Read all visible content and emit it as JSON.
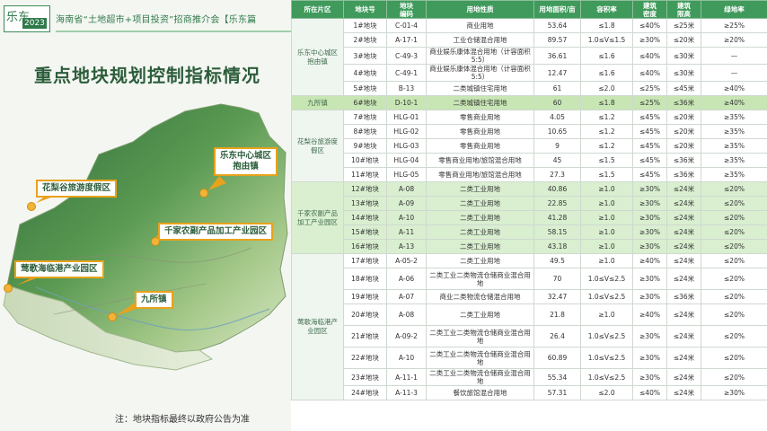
{
  "header": {
    "logo_mark": "乐东",
    "logo_year": "2023",
    "title": "海南省“土地超市+项目投资”招商推介会【乐东篇"
  },
  "main_title": "重点地块规划控制指标情况",
  "map_labels": {
    "center": "乐东中心城区\n抱由镇",
    "huali": "花梨谷旅游度假区",
    "qianjia": "千家农副产品加工产业园区",
    "yingge": "莺歌海临港产业园区",
    "jiusuo": "九所镇"
  },
  "note": "注：地块指标最终以政府公告为准",
  "table": {
    "headers": [
      "所在片区",
      "地块号",
      "地块\n编码",
      "用地性质",
      "用地面积/亩",
      "容积率",
      "建筑\n密度",
      "建筑\n限高",
      "绿地率"
    ],
    "groups": [
      {
        "area": "乐东中心城区\n抱由镇",
        "rows": [
          [
            "1#地块",
            "C-01-4",
            "商业用地",
            "53.64",
            "≤1.8",
            "≤40%",
            "≤25米",
            "≥25%"
          ],
          [
            "2#地块",
            "A-17-1",
            "工业仓储混合用地",
            "89.57",
            "1.0≤V≤1.5",
            "≥30%",
            "≤20米",
            "≥20%"
          ],
          [
            "3#地块",
            "C-49-3",
            "商业娱乐康体混合用地（计容面积5:5）",
            "36.61",
            "≤1.6",
            "≤40%",
            "≤30米",
            "—"
          ],
          [
            "4#地块",
            "C-49-1",
            "商业娱乐康体混合用地（计容面积5:5）",
            "12.47",
            "≤1.6",
            "≤40%",
            "≤30米",
            "—"
          ],
          [
            "5#地块",
            "B-13",
            "二类城镇住宅用地",
            "61",
            "≤2.0",
            "≤25%",
            "≤45米",
            "≥40%"
          ]
        ]
      },
      {
        "area": "九所镇",
        "highlight": true,
        "rows": [
          [
            "6#地块",
            "D-10-1",
            "二类城镇住宅用地",
            "60",
            "≤1.8",
            "≤25%",
            "≤36米",
            "≥40%"
          ]
        ]
      },
      {
        "area": "花梨谷旅游度\n假区",
        "rows": [
          [
            "7#地块",
            "HLG-01",
            "零售商业用地",
            "4.05",
            "≤1.2",
            "≤45%",
            "≤20米",
            "≥35%"
          ],
          [
            "8#地块",
            "HLG-02",
            "零售商业用地",
            "10.65",
            "≤1.2",
            "≤45%",
            "≤20米",
            "≥35%"
          ],
          [
            "9#地块",
            "HLG-03",
            "零售商业用地",
            "9",
            "≤1.2",
            "≤45%",
            "≤20米",
            "≥35%"
          ],
          [
            "10#地块",
            "HLG-04",
            "零售商业用地/旅馆混合用地",
            "45",
            "≤1.5",
            "≤45%",
            "≤36米",
            "≥35%"
          ],
          [
            "11#地块",
            "HLG-05",
            "零售商业用地/旅馆混合用地",
            "27.3",
            "≤1.5",
            "≤45%",
            "≤36米",
            "≥35%"
          ]
        ]
      },
      {
        "area": "千家农副产品\n加工产业园区",
        "green": true,
        "rows": [
          [
            "12#地块",
            "A-08",
            "二类工业用地",
            "40.86",
            "≥1.0",
            "≥30%",
            "≤24米",
            "≤20%"
          ],
          [
            "13#地块",
            "A-09",
            "二类工业用地",
            "22.85",
            "≥1.0",
            "≥30%",
            "≤24米",
            "≤20%"
          ],
          [
            "14#地块",
            "A-10",
            "二类工业用地",
            "41.28",
            "≥1.0",
            "≥30%",
            "≤24米",
            "≤20%"
          ],
          [
            "15#地块",
            "A-11",
            "二类工业用地",
            "58.15",
            "≥1.0",
            "≥30%",
            "≤24米",
            "≤20%"
          ],
          [
            "16#地块",
            "A-13",
            "二类工业用地",
            "43.18",
            "≥1.0",
            "≥30%",
            "≤24米",
            "≤20%"
          ]
        ]
      },
      {
        "area": "莺歌海临港产\n业园区",
        "rows": [
          [
            "17#地块",
            "A-05-2",
            "二类工业用地",
            "49.5",
            "≥1.0",
            "≥40%",
            "≤24米",
            "≤20%"
          ],
          [
            "18#地块",
            "A-06",
            "二类工业二类物流仓储商业混合用地",
            "70",
            "1.0≤V≤2.5",
            "≥30%",
            "≤24米",
            "≤20%"
          ],
          [
            "19#地块",
            "A-07",
            "商业二类物流仓储混合用地",
            "32.47",
            "1.0≤V≤2.5",
            "≥30%",
            "≤36米",
            "≤20%"
          ],
          [
            "20#地块",
            "A-08",
            "二类工业用地",
            "21.8",
            "≥1.0",
            "≥40%",
            "≤24米",
            "≤20%"
          ],
          [
            "21#地块",
            "A-09-2",
            "二类工业二类物流仓储商业混合用地",
            "26.4",
            "1.0≤V≤2.5",
            "≥30%",
            "≤24米",
            "≤20%"
          ],
          [
            "22#地块",
            "A-10",
            "二类工业二类物流仓储商业混合用地",
            "60.89",
            "1.0≤V≤2.5",
            "≥30%",
            "≤24米",
            "≤20%"
          ],
          [
            "23#地块",
            "A-11-1",
            "二类工业二类物流仓储商业混合用地",
            "55.34",
            "1.0≤V≤2.5",
            "≥30%",
            "≤24米",
            "≤20%"
          ],
          [
            "24#地块",
            "A-11-3",
            "餐饮旅馆混合用地",
            "57.31",
            "≤2.0",
            "≤40%",
            "≤24米",
            "≥30%"
          ]
        ]
      }
    ]
  }
}
